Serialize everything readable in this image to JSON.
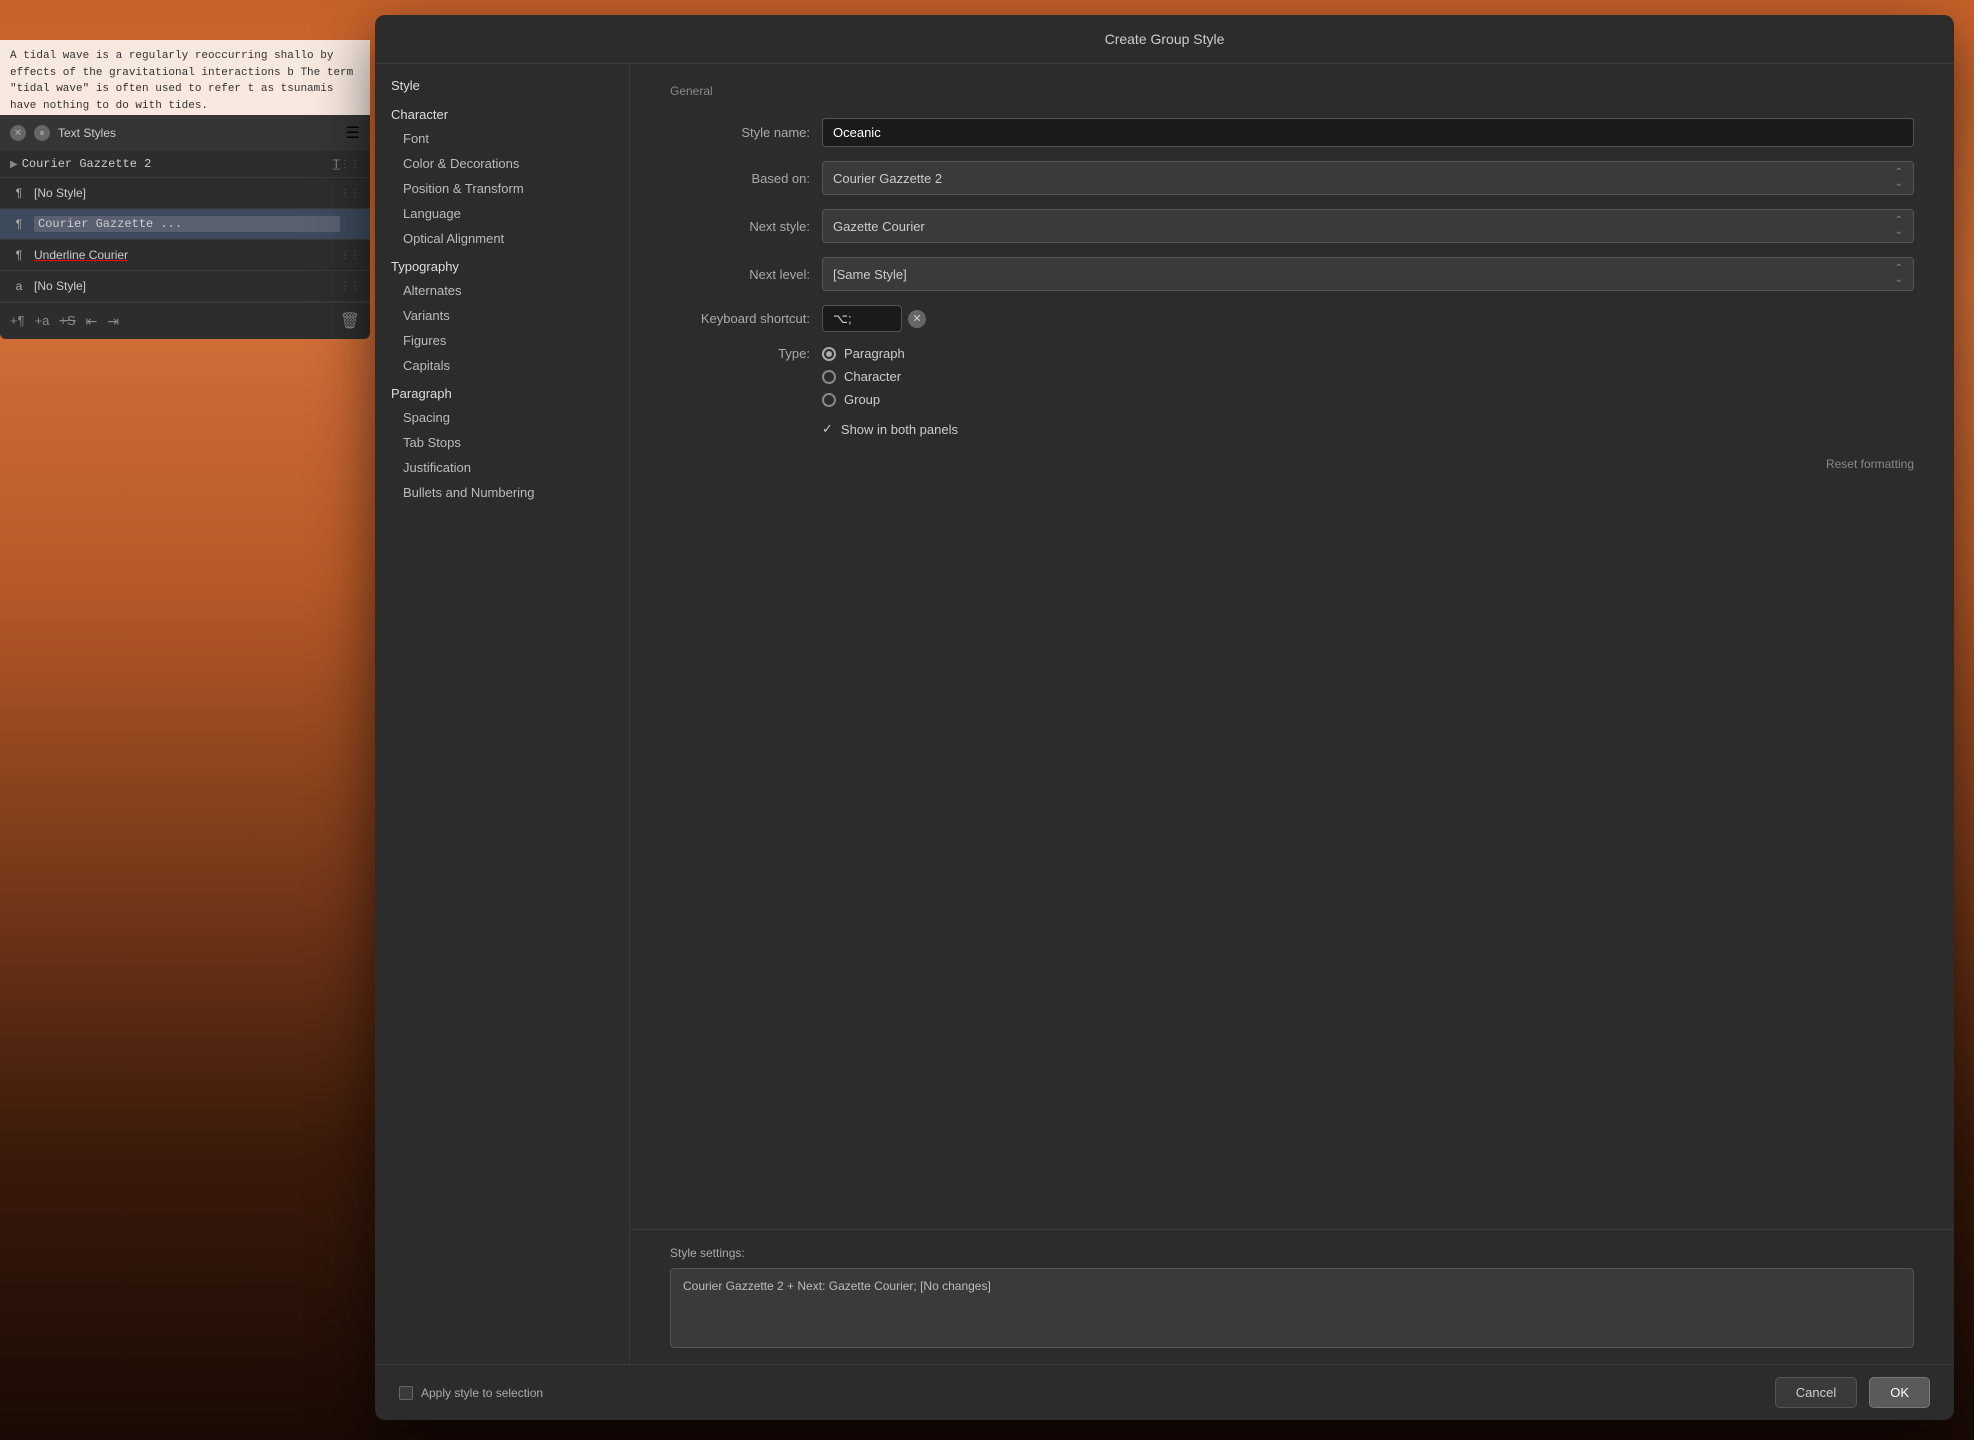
{
  "background": {
    "colors": [
      "#c8622a",
      "#d4703a",
      "#b85a28",
      "#7a3a1a",
      "#3a1a0a"
    ]
  },
  "textPreview": {
    "content": "A tidal wave is a regularly reoccurring shallo\nby effects of the gravitational interactions b\nThe term \"tidal wave\" is often used to refer t\nas tsunamis have nothing to do with tides."
  },
  "leftPanel": {
    "title": "Text Styles",
    "items": [
      {
        "id": "courier-main",
        "icon": "▶",
        "name": "Courier Gazzette 2",
        "hasHandle": true,
        "selected": false
      },
      {
        "id": "no-style-para",
        "icon": "¶",
        "name": "[No Style]",
        "hasHandle": true,
        "selected": false
      },
      {
        "id": "courier-active",
        "icon": "¶",
        "name": "Courier Gazzette ...",
        "hasHandle": true,
        "selected": true
      },
      {
        "id": "underline-style",
        "icon": "¶",
        "name": "Underline Courier",
        "hasHandle": true,
        "selected": false,
        "underline": true
      },
      {
        "id": "no-style-char",
        "icon": "a",
        "name": "[No Style]",
        "hasHandle": true,
        "selected": false
      }
    ],
    "footerIcons": [
      "¶",
      "a",
      "S"
    ],
    "footerRight": "🗑"
  },
  "dialog": {
    "title": "Create Group Style",
    "navigation": {
      "sections": [
        {
          "header": "Style",
          "items": []
        },
        {
          "header": "Character",
          "items": [
            {
              "id": "font",
              "label": "Font"
            },
            {
              "id": "color-decorations",
              "label": "Color & Decorations",
              "active": false
            },
            {
              "id": "position-transform",
              "label": "Position & Transform"
            },
            {
              "id": "language",
              "label": "Language"
            },
            {
              "id": "optical-alignment",
              "label": "Optical Alignment"
            }
          ]
        },
        {
          "header": "Typography",
          "items": [
            {
              "id": "alternates",
              "label": "Alternates"
            },
            {
              "id": "variants",
              "label": "Variants"
            },
            {
              "id": "figures",
              "label": "Figures"
            },
            {
              "id": "capitals",
              "label": "Capitals"
            }
          ]
        },
        {
          "header": "Paragraph",
          "items": [
            {
              "id": "spacing",
              "label": "Spacing"
            },
            {
              "id": "tab-stops",
              "label": "Tab Stops"
            },
            {
              "id": "justification",
              "label": "Justification"
            },
            {
              "id": "bullets-numbering",
              "label": "Bullets and Numbering"
            }
          ]
        }
      ]
    },
    "form": {
      "sectionLabel": "General",
      "styleNameLabel": "Style name:",
      "styleNameValue": "Oceanic",
      "basedOnLabel": "Based on:",
      "basedOnValue": "Courier Gazzette 2",
      "nextStyleLabel": "Next style:",
      "nextStyleValue": "Gazette Courier",
      "nextLevelLabel": "Next level:",
      "nextLevelValue": "[Same Style]",
      "keyboardShortcutLabel": "Keyboard shortcut:",
      "keyboardShortcutValue": "⌥;",
      "typeLabel": "Type:",
      "typeOptions": [
        {
          "id": "paragraph",
          "label": "Paragraph",
          "selected": true
        },
        {
          "id": "character",
          "label": "Character",
          "selected": false
        },
        {
          "id": "group",
          "label": "Group",
          "selected": false
        }
      ],
      "showBothPanels": true,
      "showBothPanelsLabel": "Show in both panels",
      "resetFormattingLabel": "Reset formatting"
    },
    "styleSettings": {
      "label": "Style settings:",
      "value": "Courier Gazzette 2 + Next: Gazette Courier; [No changes]"
    },
    "footer": {
      "applyStyleLabel": "Apply style to selection",
      "cancelLabel": "Cancel",
      "okLabel": "OK"
    }
  }
}
